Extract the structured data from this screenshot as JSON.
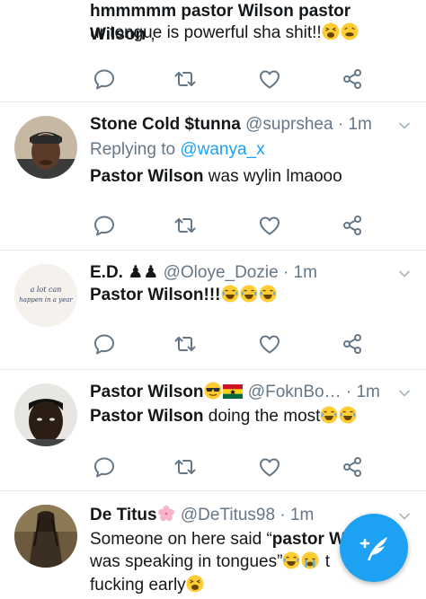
{
  "colors": {
    "accent": "#1da1f2",
    "text": "#14171a",
    "muted": "#657786",
    "divider": "#e1e8ed"
  },
  "tweet0": {
    "text_bold_1": "mmm pastor Wilson pastor Wilson",
    "text_rest": " ,",
    "line2": "ur tongue is powerful sha shit!!",
    "emojis": [
      "weary-face",
      "tired-face"
    ]
  },
  "tweet1": {
    "name": "Stone Cold $tunna",
    "handle": "@suprshea",
    "sep": "·",
    "time": "1m",
    "replying_label": "Replying to",
    "replying_to": "@wanya_x",
    "text_bold": "Pastor Wilson",
    "text_rest": " was wylin lmaooo"
  },
  "tweet2": {
    "name": "E.D.",
    "name_badges": "♟♟",
    "handle": "@Oloye_Dozie",
    "sep": "·",
    "time": "1m",
    "avatar_text_1": "a lot can",
    "avatar_text_2": "happen in a year",
    "text_bold": "Pastor Wilson!!!",
    "emojis": [
      "joy",
      "joy",
      "joy"
    ]
  },
  "tweet3": {
    "name": "Pastor Wilson",
    "name_emojis": [
      "sunglasses-face",
      "ghana-flag"
    ],
    "handle": "@FoknBo…",
    "sep": "·",
    "time": "1m",
    "text_bold": "Pastor Wilson",
    "text_rest": " doing the most",
    "emojis": [
      "joy",
      "joy"
    ]
  },
  "tweet4": {
    "name": "De Titus",
    "name_emoji": "cherry-blossom",
    "handle": "@DeTitus98",
    "sep": "·",
    "time": "1m",
    "line1_plain": "Someone on here said “",
    "line1_bold": "pastor W",
    "line2_plain": "was speaking in tongues”",
    "line2_emojis": [
      "joy",
      "loudly-crying"
    ],
    "line2_tail": " t",
    "line3_plain": "fucking early",
    "line3_emoji": "weary-face"
  },
  "icons": {
    "reply": "reply-icon",
    "retweet": "retweet-icon",
    "like": "heart-icon",
    "share": "share-icon",
    "caret": "chevron-down-icon",
    "compose": "compose-tweet-icon"
  }
}
